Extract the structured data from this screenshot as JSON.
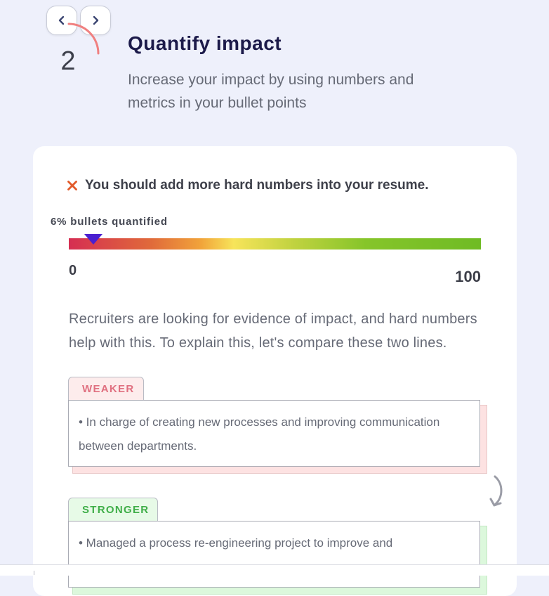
{
  "step": {
    "number": "2",
    "title": "Quantify impact",
    "subtitle": "Increase your impact by using numbers and metrics in your bullet points",
    "progress_fraction": 0.25
  },
  "nav": {
    "prev_icon": "chevron-left-icon",
    "next_icon": "chevron-right-icon"
  },
  "verdict": {
    "icon": "close-icon",
    "text": "You should add more hard numbers into your resume."
  },
  "gauge": {
    "label": "6% bullets quantified",
    "value": 6,
    "min": "0",
    "max": "100",
    "min_value": 0,
    "max_value": 100
  },
  "explanation": "Recruiters are looking for evidence of impact, and hard numbers help with this. To explain this, let's compare these two lines.",
  "examples": {
    "weaker": {
      "tag": "WEAKER",
      "text": "• In charge of creating new processes and improving communication between departments."
    },
    "stronger": {
      "tag": "STRONGER",
      "text": "• Managed a process re-engineering project to improve and"
    }
  },
  "colors": {
    "accent_arc": "#f08080",
    "marker": "#4a1fd0",
    "verdict_icon": "#e25a2a",
    "title": "#1c1a4a"
  }
}
